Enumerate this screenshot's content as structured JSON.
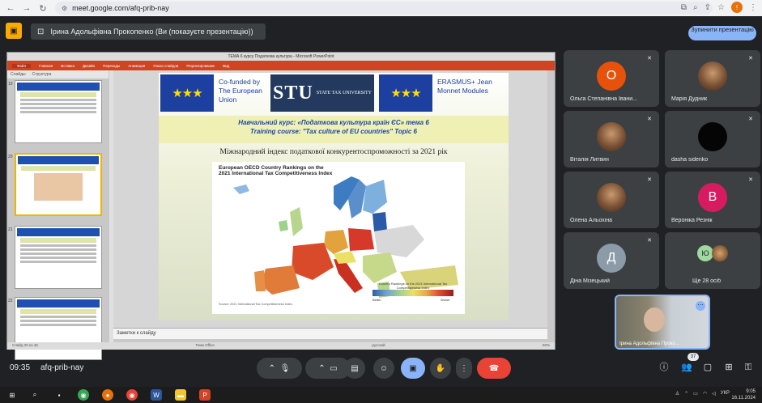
{
  "browser": {
    "url": "meet.google.com/afq-prib-nay",
    "profile_initial": "!"
  },
  "meet": {
    "presenter_label": "Ірина Адольфівна Прокопенко (Ви (показуєте презентацію))",
    "stop_button": "Зупинити презентацію"
  },
  "powerpoint": {
    "window_title": "ТЕМА 6 курсу Податкова культура - Microsoft PowerPoint",
    "ribbon_tabs": [
      "Файл",
      "Главная",
      "Вставка",
      "Дизайн",
      "Переходы",
      "Анимация",
      "Показ слайдов",
      "Рецензирование",
      "Вид"
    ],
    "side_tabs": [
      "Слайды",
      "Структура"
    ],
    "thumb_numbers": [
      "19",
      "20",
      "21",
      "22"
    ],
    "notes_placeholder": "Заметки к слайду",
    "status_left": "Слайд 20 из 46",
    "status_theme": "Тема Office",
    "status_lang": "русский",
    "zoom": "50%"
  },
  "slide": {
    "cofunded": "Co-funded by The European Union",
    "stu_big": "STU",
    "stu_small": "STATE TAX UNIVERSITY",
    "erasmus": "ERASMUS+ Jean Monnet Modules",
    "course_line1": "Навчальний курс: «Податкова культура країн ЄС» тема 6",
    "course_line2": "Training course: \"Tax culture of EU countries\" Topic 6",
    "heading": "Міжнародний індекс податкової конкурентоспроможності за 2021 рік",
    "map_title_1": "European OECD Country Rankings on the",
    "map_title_2": "2021 International Tax Competitiveness Index",
    "legend_title": "Country Rankings on the 2021 International Tax Competitiveness Index",
    "legend_better": "Better",
    "legend_worse": "Worse",
    "source": "Source: 2021 International Tax Competitiveness Index."
  },
  "participants": [
    {
      "name": "Ольга Степанівна Івани...",
      "initial": "О",
      "color": "#e8510a",
      "type": "letter"
    },
    {
      "name": "Марія Дудник",
      "initial": "",
      "color": "",
      "type": "photo"
    },
    {
      "name": "Віталія Литвин",
      "initial": "",
      "color": "",
      "type": "photo"
    },
    {
      "name": "dasha sidenko",
      "initial": "",
      "color": "",
      "type": "dark"
    },
    {
      "name": "Олена Альохіна",
      "initial": "",
      "color": "",
      "type": "photo"
    },
    {
      "name": "Вероніка Резнік",
      "initial": "В",
      "color": "#d81b60",
      "type": "letter"
    },
    {
      "name": "Діна Мізецький",
      "initial": "Д",
      "color": "#8c9ba8",
      "type": "letter"
    },
    {
      "name": "Ще 28 осіб",
      "initial": "Ю",
      "color": "#9fd8a0",
      "type": "more"
    }
  ],
  "self_view": {
    "name": "Ірина Адольфівна Проко..."
  },
  "controls": {
    "time": "09:35",
    "meeting_code": "afq-prib-nay",
    "people_count": "37"
  },
  "taskbar": {
    "lang": "УКР",
    "time": "9:05",
    "date": "16.11.2024"
  },
  "chart_data": {
    "type": "heatmap",
    "title": "European OECD Country Rankings on the 2021 International Tax Competitiveness Index"
  }
}
